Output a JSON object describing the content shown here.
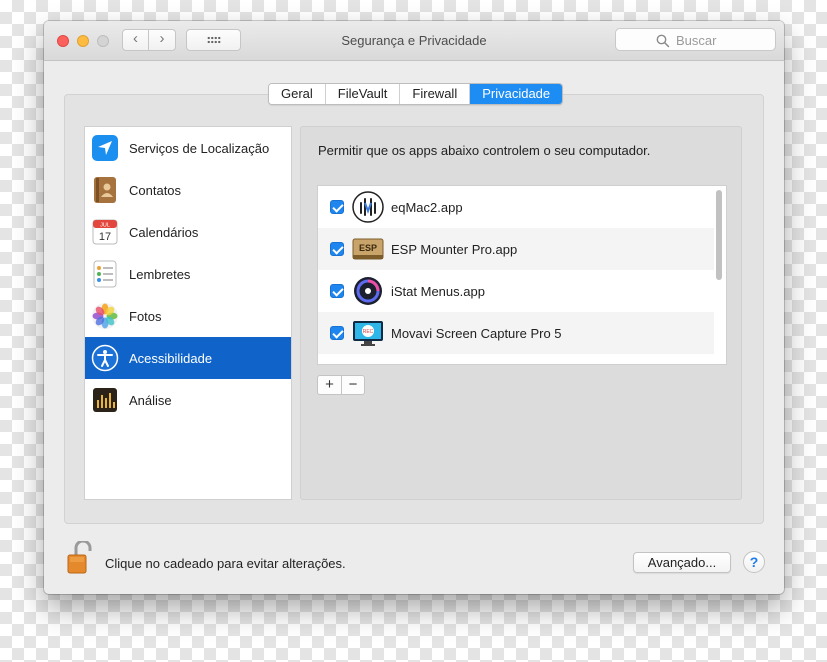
{
  "window": {
    "title": "Segurança e Privacidade",
    "search_placeholder": "Buscar",
    "nav_back": "‹",
    "nav_forward": "›"
  },
  "tabs": [
    {
      "label": "Geral",
      "active": false
    },
    {
      "label": "FileVault",
      "active": false
    },
    {
      "label": "Firewall",
      "active": false
    },
    {
      "label": "Privacidade",
      "active": true
    }
  ],
  "categories": [
    {
      "label": "Serviços de Localização",
      "icon": "location-arrow-icon",
      "selected": false
    },
    {
      "label": "Contatos",
      "icon": "contacts-book-icon",
      "selected": false
    },
    {
      "label": "Calendários",
      "icon": "calendar-icon",
      "selected": false
    },
    {
      "label": "Lembretes",
      "icon": "reminders-list-icon",
      "selected": false
    },
    {
      "label": "Fotos",
      "icon": "photos-flower-icon",
      "selected": false
    },
    {
      "label": "Acessibilidade",
      "icon": "accessibility-person-icon",
      "selected": true
    },
    {
      "label": "Análise",
      "icon": "analytics-chart-icon",
      "selected": false
    }
  ],
  "calendar_icon": {
    "month": "JUL",
    "day": "17"
  },
  "main": {
    "permission_text": "Permitir que os apps abaixo controlem o seu computador.",
    "apps": [
      {
        "name": "eqMac2.app",
        "checked": true,
        "icon": "eqmac-waveform-icon"
      },
      {
        "name": "ESP Mounter Pro.app",
        "checked": true,
        "icon": "esp-drive-icon"
      },
      {
        "name": "iStat Menus.app",
        "checked": true,
        "icon": "istat-gauge-icon"
      },
      {
        "name": "Movavi Screen Capture Pro 5",
        "checked": true,
        "icon": "movavi-monitor-icon"
      }
    ],
    "add_label": "+",
    "remove_label": "−",
    "movavi_rec": "REC",
    "esp_label": "ESP"
  },
  "footer": {
    "lock_text": "Clique no cadeado para evitar alterações.",
    "advanced_label": "Avançado...",
    "help_label": "?"
  },
  "colors": {
    "accent": "#1d8cf3",
    "selection": "#1064c9",
    "checkbox": "#1e86ee"
  }
}
